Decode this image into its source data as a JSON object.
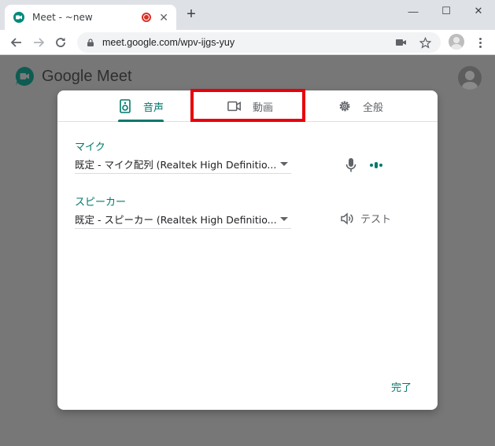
{
  "browser": {
    "tab_title": "Meet - ~new",
    "new_tab_symbol": "+",
    "url": "meet.google.com/wpv-ijgs-yuy",
    "window_controls": {
      "minimize": "—",
      "maximize": "☐",
      "close": "✕"
    },
    "tab_close": "✕"
  },
  "page": {
    "brand_name": "Google Meet"
  },
  "dialog": {
    "tabs": [
      {
        "label": "音声",
        "icon": "speaker-icon",
        "active": true
      },
      {
        "label": "動画",
        "icon": "video-camera-icon",
        "active": false
      },
      {
        "label": "全般",
        "icon": "gear-icon",
        "active": false
      }
    ],
    "microphone": {
      "label": "マイク",
      "selected": "既定 - マイク配列 (Realtek High Definitio..."
    },
    "speaker": {
      "label": "スピーカー",
      "selected": "既定 - スピーカー (Realtek High Definitio...",
      "test_label": "テスト"
    },
    "done_label": "完了"
  },
  "colors": {
    "accent": "#00796b",
    "highlight": "#e8000b",
    "chrome_bg": "#dee1e6",
    "overlay": "#777777"
  }
}
